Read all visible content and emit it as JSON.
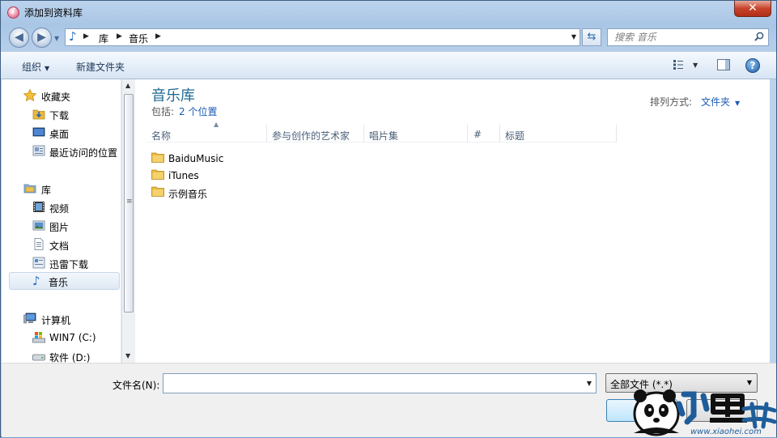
{
  "window": {
    "title": "添加到资料库",
    "close_label": "✕"
  },
  "address_bar": {
    "crumbs": [
      "库",
      "音乐"
    ],
    "search_placeholder": "搜索 音乐"
  },
  "toolbar": {
    "organize_label": "组织",
    "new_folder_label": "新建文件夹"
  },
  "sidebar": {
    "favorites": {
      "label": "收藏夹",
      "items": [
        "下载",
        "桌面",
        "最近访问的位置"
      ]
    },
    "libraries": {
      "label": "库",
      "items": [
        "视频",
        "图片",
        "文档",
        "迅雷下载",
        "音乐"
      ]
    },
    "computer": {
      "label": "计算机",
      "items": [
        "WIN7 (C:)",
        "软件 (D:)"
      ]
    },
    "selected": "音乐"
  },
  "main": {
    "library_title": "音乐库",
    "includes_label": "包括:",
    "includes_link": "2 个位置",
    "arrange_label": "排列方式:",
    "arrange_value": "文件夹",
    "columns": [
      "名称",
      "参与创作的艺术家",
      "唱片集",
      "#",
      "标题"
    ],
    "files": [
      "BaiduMusic",
      "iTunes",
      "示例音乐"
    ]
  },
  "bottom": {
    "filename_label": "文件名(N):",
    "filename_value": "",
    "filetype_value": "全部文件 (*.*)"
  },
  "watermark": {
    "url": "www.xiaohei.com"
  },
  "colors": {
    "accent": "#1e6a93",
    "link": "#1c5bb5",
    "folder": "#e8b940"
  }
}
